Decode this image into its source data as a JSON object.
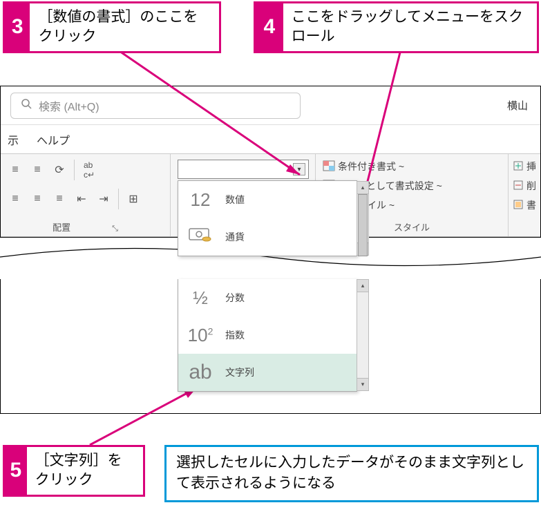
{
  "callouts": {
    "c3": {
      "num": "3",
      "text": "［数値の書式］のここをクリック"
    },
    "c4": {
      "num": "4",
      "text": "ここをドラッグしてメニューをスクロール"
    },
    "c5": {
      "num": "5",
      "text": "［文字列］をクリック"
    }
  },
  "info_text": "選択したセルに入力したデータがそのまま文字列として表示されるようになる",
  "search": {
    "placeholder": "検索 (Alt+Q)"
  },
  "user_name": "横山",
  "tabs": {
    "view": "示",
    "help": "ヘルプ"
  },
  "ribbon": {
    "alignment_label": "配置",
    "styles_label": "スタイル",
    "cond_format": "条件付き書式 ~",
    "table_format": "ーブルとして書式設定 ~",
    "cell_style": "のスタイル ~",
    "insert": "挿",
    "delete": "削",
    "format": "書"
  },
  "number_format": {
    "items": [
      {
        "icon": "12",
        "label": "数値"
      },
      {
        "icon": "¥",
        "label": "通貨"
      },
      {
        "icon": "½",
        "label": "分数"
      },
      {
        "icon": "10²",
        "label": "指数"
      },
      {
        "icon": "ab",
        "label": "文字列"
      }
    ]
  }
}
